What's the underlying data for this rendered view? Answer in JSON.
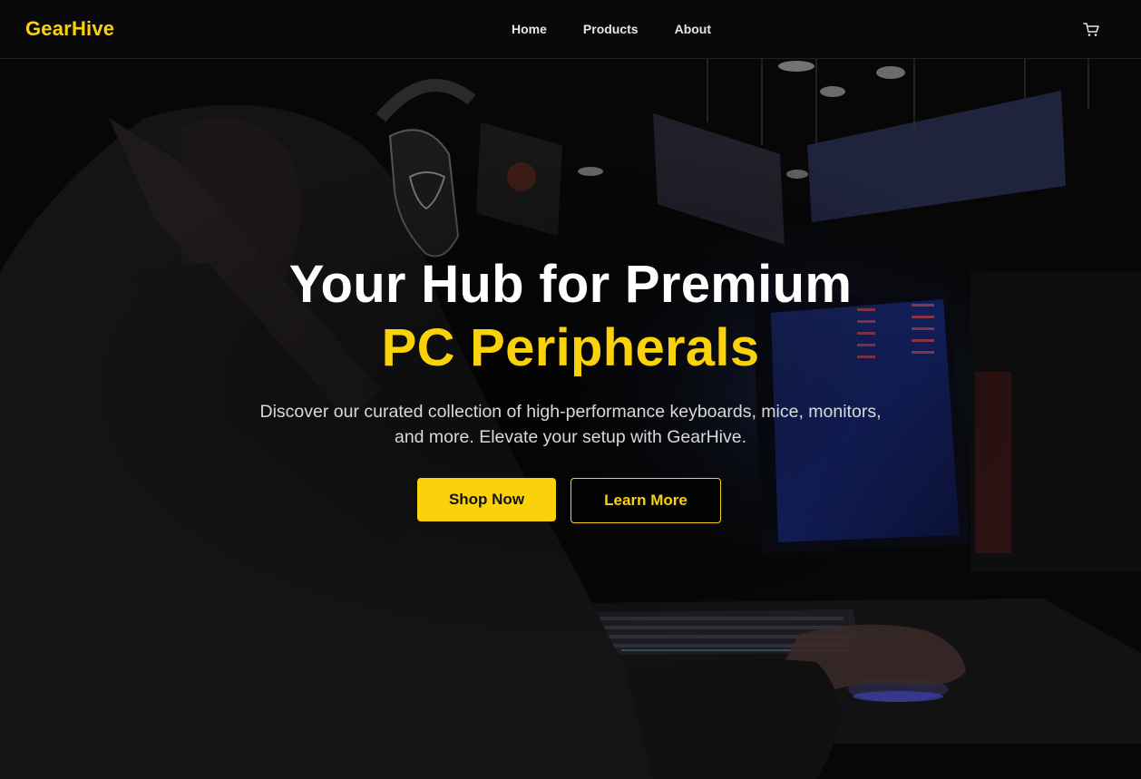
{
  "navbar": {
    "brand": "GearHive",
    "links": [
      "Home",
      "Products",
      "About"
    ],
    "cart_icon": "cart-icon"
  },
  "hero": {
    "headline_line1": "Your Hub for Premium",
    "headline_line2": "PC Peripherals",
    "subtext": "Discover our curated collection of high-performance keyboards, mice, monitors, and more. Elevate your setup with GearHive.",
    "primary_button": "Shop Now",
    "secondary_button": "Learn More"
  },
  "colors": {
    "accent": "#fad20c",
    "background": "#070707",
    "text": "#ffffff"
  }
}
